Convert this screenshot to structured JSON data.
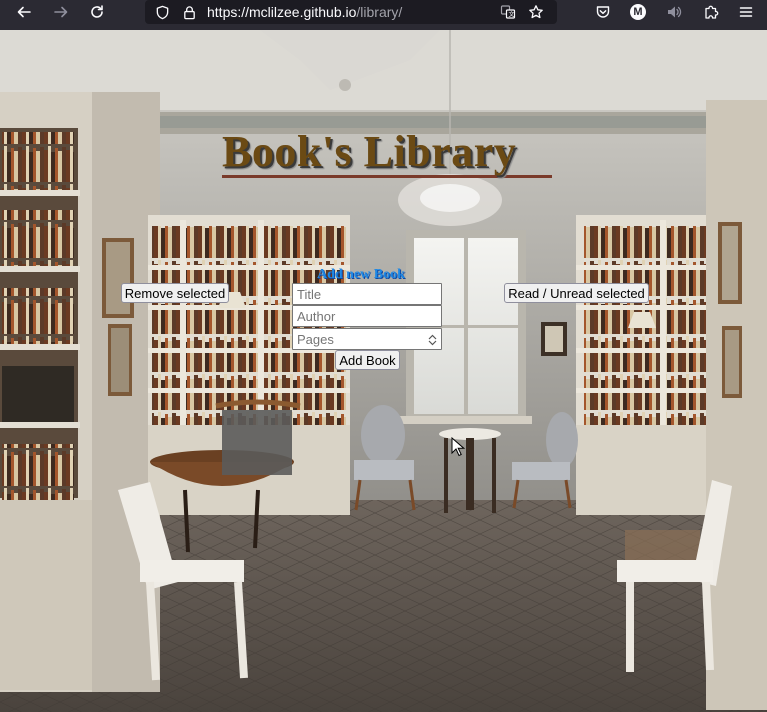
{
  "browser": {
    "url_host": "https://mclilzee.github.io",
    "url_path": "/library/",
    "profile_initial": "M",
    "icons": {
      "back": "back-arrow-icon",
      "forward": "forward-arrow-icon",
      "reload": "reload-icon",
      "shield": "tracking-protection-shield-icon",
      "lock": "lock-icon",
      "translate": "translate-icon",
      "bookmark": "bookmark-star-icon",
      "pocket": "pocket-icon",
      "account": "account-avatar-icon",
      "mute": "speaker-icon",
      "extensions": "extensions-puzzle-icon",
      "menu": "hamburger-menu-icon"
    }
  },
  "page": {
    "title": "Book's Library",
    "form_title": "Add new Book",
    "remove_selected_label": "Remove selected",
    "toggle_read_label": "Read / Unread selected",
    "title_placeholder": "Title",
    "author_placeholder": "Author",
    "pages_placeholder": "Pages",
    "add_book_label": "Add Book"
  },
  "colors": {
    "chrome_bg": "#2b2a33",
    "urlbar_bg": "#1c1b22",
    "title_brown": "#6b4a14",
    "form_title_blue": "#1e88e5"
  }
}
